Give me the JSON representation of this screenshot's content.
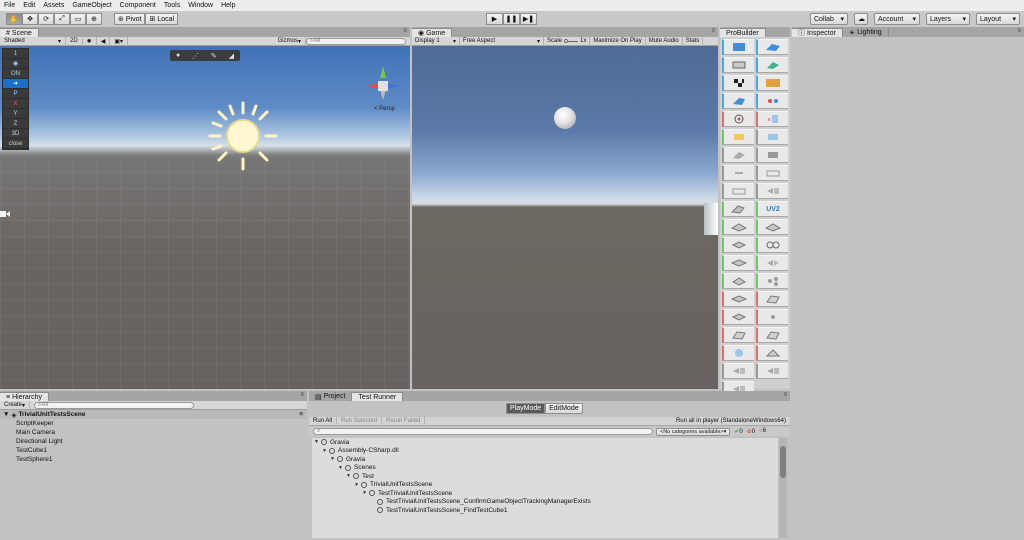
{
  "menu": [
    "File",
    "Edit",
    "Assets",
    "GameObject",
    "Component",
    "Tools",
    "Window",
    "Help"
  ],
  "toolbar": {
    "pivot": "Pivot",
    "local": "Local",
    "collab": "Collab",
    "account": "Account",
    "layers": "Layers",
    "layout": "Layout"
  },
  "scene": {
    "tab": "Scene",
    "shading": "Shaded",
    "mode2d": "2D",
    "gizmos": "Gizmos",
    "search_placeholder": "All",
    "persp": "< Persp",
    "overlay": [
      "1",
      "ON",
      "P",
      "X",
      "Y",
      "Z",
      "3D",
      "close"
    ]
  },
  "game": {
    "tab": "Game",
    "display": "Display 1",
    "aspect": "Free Aspect",
    "scale_label": "Scale",
    "scale_value": "1x",
    "maximize": "Maximize On Play",
    "mute": "Mute Audio",
    "stats": "Stats"
  },
  "probuilder": {
    "tab": "ProBuilder",
    "uv_label": "UV2"
  },
  "inspector": {
    "tab_inspector": "Inspector",
    "tab_lighting": "Lighting"
  },
  "hierarchy": {
    "tab": "Hierarchy",
    "create": "Create",
    "search_placeholder": "All",
    "scene_name": "TrivialUnitTestsScene",
    "items": [
      "ScriptKeeper",
      "Main Camera",
      "Directional Light",
      "TestCube1",
      "TestSphere1"
    ]
  },
  "testrunner": {
    "tab_project": "Project",
    "tab_runner": "Test Runner",
    "playmode": "PlayMode",
    "editmode": "EditMode",
    "run_all": "Run All",
    "run_selected": "Run Selected",
    "rerun_failed": "Rerun Failed",
    "run_all_player": "Run all in player (StandaloneWindows64)",
    "categories": "<No categories available>",
    "count_pass": "0",
    "count_fail": "0",
    "count_skip": "6",
    "tree": [
      {
        "label": "Gravia",
        "depth": 0
      },
      {
        "label": "Assembly-CSharp.dll",
        "depth": 1
      },
      {
        "label": "Gravia",
        "depth": 2
      },
      {
        "label": "Scenes",
        "depth": 3
      },
      {
        "label": "Test",
        "depth": 4
      },
      {
        "label": "TrivialUnitTestsScene",
        "depth": 5
      },
      {
        "label": "TestTrivialUnitTestsScene",
        "depth": 6
      },
      {
        "label": "TestTrivialUnitTestsScene_ConfirmGameObjectTrackingManagerExists",
        "depth": 7
      },
      {
        "label": "TestTrivialUnitTestsScene_FindTestCube1",
        "depth": 7
      }
    ]
  }
}
